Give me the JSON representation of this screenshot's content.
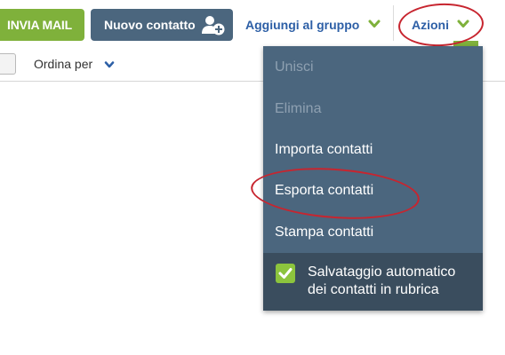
{
  "toolbar": {
    "send_mail_label": "INVIA MAIL",
    "new_contact_label": "Nuovo contatto",
    "add_to_group_label": "Aggiungi al gruppo",
    "actions_label": "Azioni"
  },
  "list_header": {
    "sort_label": "Ordina per"
  },
  "actions_menu": {
    "items": [
      {
        "label": "Unisci",
        "enabled": false
      },
      {
        "label": "Elimina",
        "enabled": false
      },
      {
        "label": "Importa contatti",
        "enabled": true
      },
      {
        "label": "Esporta contatti",
        "enabled": true
      },
      {
        "label": "Stampa contatti",
        "enabled": true
      }
    ],
    "autosave": {
      "checked": true,
      "label_line1": "Salvataggio automatico",
      "label_line2": "dei contatti in rubrica"
    }
  },
  "icons": {
    "new_contact": "add-person-icon",
    "dropdown": "chevron-down-icon",
    "checkbox": "checkmark-icon"
  },
  "colors": {
    "send_button": "#7fb13b",
    "toolbar_button": "#4b667e",
    "link_text": "#2d5fa6",
    "menu_bg": "#4b667e",
    "menu_footer_bg": "#3a4d5e",
    "annotation_ring": "#c7252f"
  }
}
